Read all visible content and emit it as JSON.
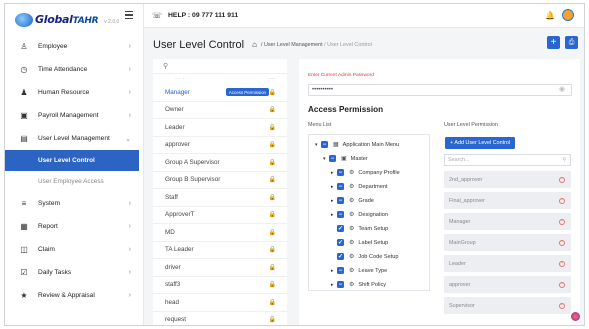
{
  "brand": {
    "name": "Global",
    "suffix": "TAHR",
    "version": "v 2.0.0"
  },
  "header": {
    "help_text": "HELP : 09 777 111 911"
  },
  "sidebar": {
    "items": [
      {
        "label": "Employee",
        "icon": "users-icon"
      },
      {
        "label": "Time Attendance",
        "icon": "clock-icon"
      },
      {
        "label": "Human Resource",
        "icon": "people-icon"
      },
      {
        "label": "Payroll Management",
        "icon": "money-icon"
      },
      {
        "label": "User Level Management",
        "icon": "user-level-icon"
      },
      {
        "label": "System",
        "icon": "sliders-icon"
      },
      {
        "label": "Report",
        "icon": "report-icon"
      },
      {
        "label": "Claim",
        "icon": "claim-icon"
      },
      {
        "label": "Daily Tasks",
        "icon": "tasks-icon"
      },
      {
        "label": "Review & Appraisal",
        "icon": "trophy-icon"
      }
    ],
    "sub_items": [
      {
        "label": "User Level Control",
        "active": true
      },
      {
        "label": "User Employee Access",
        "active": false
      }
    ]
  },
  "page": {
    "title": "User Level Control",
    "breadcrumb_parent": "User Level Management",
    "breadcrumb_sep": "/",
    "breadcrumb_current": "User Level Control"
  },
  "levels": {
    "selected_badge": "Access Permission",
    "items": [
      "Manager",
      "Owner",
      "Leader",
      "approver",
      "Group A Supervisor",
      "Group B Supervisor",
      "Staff",
      "ApproverT",
      "MD",
      "TA Leader",
      "driver",
      "staff3",
      "head",
      "request"
    ]
  },
  "permission": {
    "error": "Enter Current Admin Password",
    "password_value": "••••••••••",
    "title": "Access Permission",
    "menu_list_label": "Menu List",
    "user_level_permission_label": "User Level Permission",
    "add_button": "+ Add User Level Control",
    "search_placeholder": "Search...",
    "tree": [
      {
        "label": "Application Main Menu",
        "level": 0,
        "arrow": "▾"
      },
      {
        "label": "Master",
        "level": 1,
        "arrow": "▾"
      },
      {
        "label": "Company Profile",
        "level": 2,
        "arrow": "▸"
      },
      {
        "label": "Department",
        "level": 2,
        "arrow": "▸"
      },
      {
        "label": "Grade",
        "level": 2,
        "arrow": "▸"
      },
      {
        "label": "Designation",
        "level": 2,
        "arrow": "▸"
      },
      {
        "label": "Team Setup",
        "level": 2,
        "arrow": ""
      },
      {
        "label": "Label Setup",
        "level": 2,
        "arrow": ""
      },
      {
        "label": "Job Code Setup",
        "level": 2,
        "arrow": ""
      },
      {
        "label": "Leave Type",
        "level": 2,
        "arrow": "▸"
      },
      {
        "label": "Shift Policy",
        "level": 2,
        "arrow": "▸"
      }
    ],
    "user_levels": [
      "2nd_approver",
      "Final_approver",
      "Manager",
      "MainGroup",
      "Leader",
      "approver",
      "Supervisor"
    ]
  }
}
